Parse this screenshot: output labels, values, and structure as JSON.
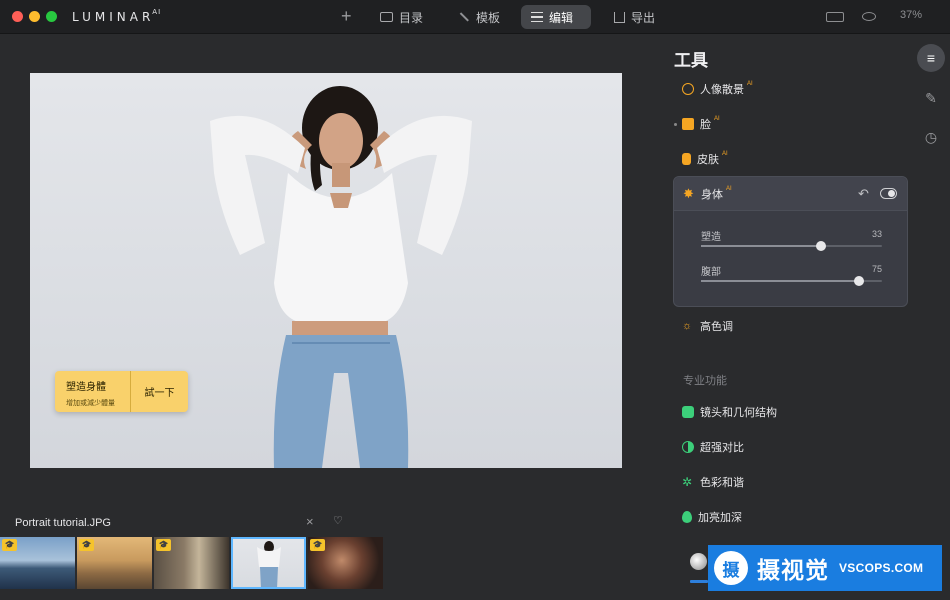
{
  "app": {
    "name": "LUMINAR",
    "name_suffix": "AI"
  },
  "topnav": {
    "add_icon": "plus-icon",
    "catalog": "目录",
    "templates": "模板",
    "edit": "编辑",
    "export": "导出",
    "zoom": "37%"
  },
  "canvas": {
    "tooltip_title": "塑造身體",
    "tooltip_sub": "增加或減少體量",
    "tooltip_button": "試一下"
  },
  "filmstrip": {
    "filename": "Portrait tutorial.JPG",
    "close_icon": "×",
    "heart_icon": "♡",
    "badge_glyph": "🎓"
  },
  "panel": {
    "title": "工具",
    "tools": [
      {
        "label": "人像散景",
        "ai": "AI",
        "color": "#f5a623",
        "icon": "bokeh-icon"
      },
      {
        "label": "脸",
        "ai": "AI",
        "color": "#f5a623",
        "icon": "face-icon"
      },
      {
        "label": "皮肤",
        "ai": "AI",
        "color": "#f5a623",
        "icon": "skin-icon"
      }
    ],
    "body": {
      "label": "身体",
      "ai": "AI",
      "sliders": [
        {
          "label": "塑造",
          "value": "33",
          "pct": 66.5
        },
        {
          "label": "腹部",
          "value": "75",
          "pct": 87.5
        }
      ]
    },
    "high_key": "高色调",
    "pro_section": "专业功能",
    "pro_tools": [
      {
        "label": "镜头和几何结构",
        "color": "#3ccf7a",
        "icon": "camera-icon"
      },
      {
        "label": "超强对比",
        "color": "#3ccf7a",
        "icon": "contrast-icon"
      },
      {
        "label": "色彩和谐",
        "color": "#3ccf7a",
        "icon": "gear-icon"
      },
      {
        "label": "加亮加深",
        "color": "#3ccf7a",
        "icon": "drop-icon"
      }
    ]
  },
  "watermark": {
    "glyph": "摄",
    "cn": "摄视觉",
    "en": "VSCOPS.COM"
  }
}
